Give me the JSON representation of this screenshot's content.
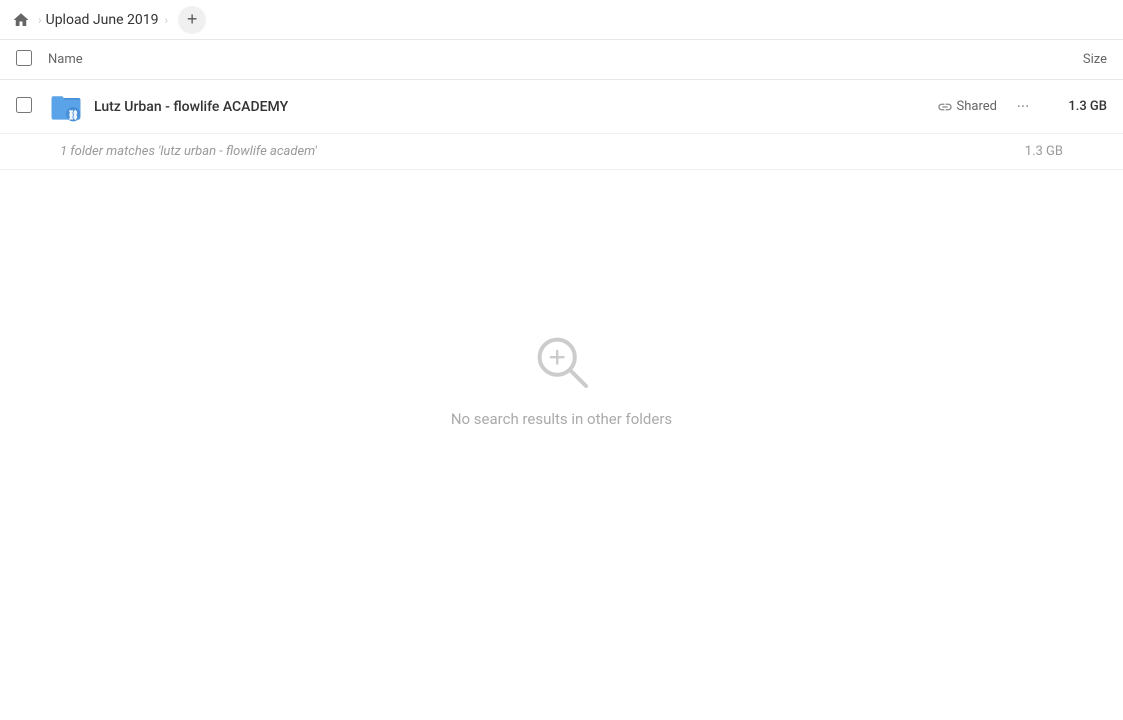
{
  "topbar": {
    "home_label": "Home",
    "breadcrumb_title": "Upload June 2019",
    "add_button_label": "+"
  },
  "table": {
    "col_name": "Name",
    "col_size": "Size"
  },
  "file_row": {
    "name": "Lutz Urban - flowlife ACADEMY",
    "shared_label": "Shared",
    "size": "1.3 GB",
    "more_label": "···"
  },
  "match_info": {
    "text": "1 folder matches 'lutz urban - flowlife academ'",
    "size": "1.3 GB"
  },
  "empty_state": {
    "icon_label": "search-icon",
    "text": "No search results in other folders"
  }
}
